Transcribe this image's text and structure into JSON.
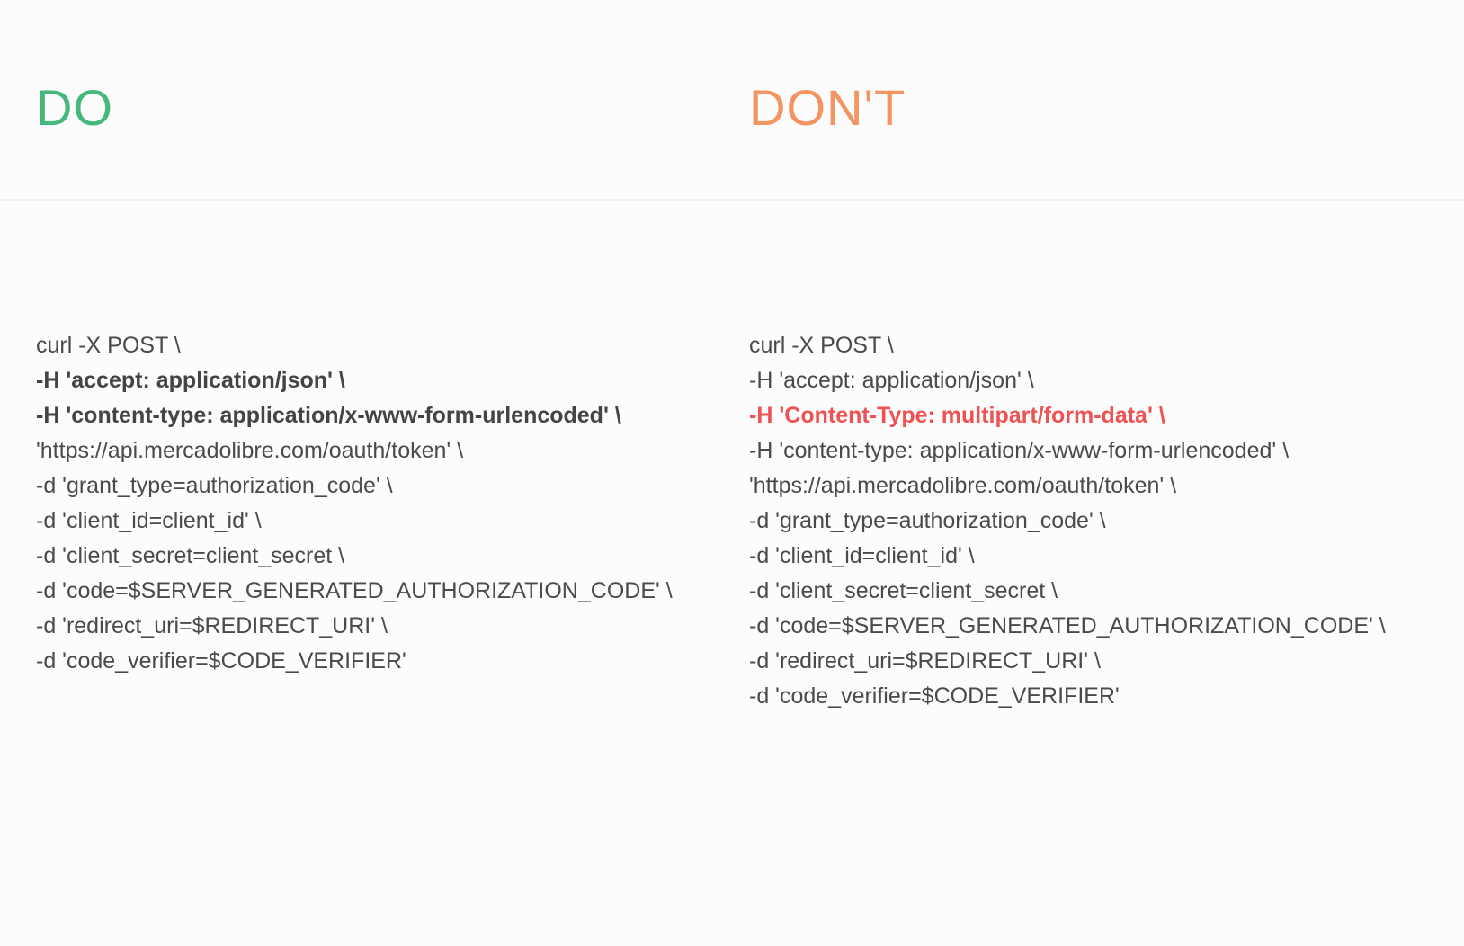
{
  "do_column": {
    "heading": "DO",
    "heading_color": "#45b97c",
    "lines": [
      {
        "text": "curl -X POST \\",
        "style": "normal"
      },
      {
        "text": "-H 'accept: application/json' \\",
        "style": "bold"
      },
      {
        "text": "-H 'content-type: application/x-www-form-urlencoded' \\",
        "style": "bold"
      },
      {
        "text": "'https://api.mercadolibre.com/oauth/token' \\",
        "style": "normal"
      },
      {
        "text": "-d 'grant_type=authorization_code' \\",
        "style": "normal"
      },
      {
        "text": "-d 'client_id=client_id' \\",
        "style": "normal"
      },
      {
        "text": "-d 'client_secret=client_secret \\",
        "style": "normal"
      },
      {
        "text": "-d 'code=$SERVER_GENERATED_AUTHORIZATION_CODE' \\",
        "style": "normal"
      },
      {
        "text": "-d 'redirect_uri=$REDIRECT_URI' \\",
        "style": "normal"
      },
      {
        "text": "-d 'code_verifier=$CODE_VERIFIER'",
        "style": "normal"
      }
    ]
  },
  "dont_column": {
    "heading": "DON'T",
    "heading_color": "#f39562",
    "lines": [
      {
        "text": "curl -X POST \\",
        "style": "normal"
      },
      {
        "text": "-H 'accept: application/json' \\",
        "style": "normal"
      },
      {
        "text": "-H 'Content-Type: multipart/form-data' \\",
        "style": "error"
      },
      {
        "text": "-H 'content-type: application/x-www-form-urlencoded' \\",
        "style": "normal"
      },
      {
        "text": "'https://api.mercadolibre.com/oauth/token' \\",
        "style": "normal"
      },
      {
        "text": "-d 'grant_type=authorization_code' \\",
        "style": "normal"
      },
      {
        "text": "-d 'client_id=client_id' \\",
        "style": "normal"
      },
      {
        "text": "-d 'client_secret=client_secret \\",
        "style": "normal"
      },
      {
        "text": "-d 'code=$SERVER_GENERATED_AUTHORIZATION_CODE' \\",
        "style": "normal"
      },
      {
        "text": "-d 'redirect_uri=$REDIRECT_URI' \\",
        "style": "normal"
      },
      {
        "text": "-d 'code_verifier=$CODE_VERIFIER'",
        "style": "normal"
      }
    ]
  },
  "colors": {
    "code_text": "#4a4a4a",
    "error_text": "#ee5253",
    "background": "#fcfcfc"
  }
}
